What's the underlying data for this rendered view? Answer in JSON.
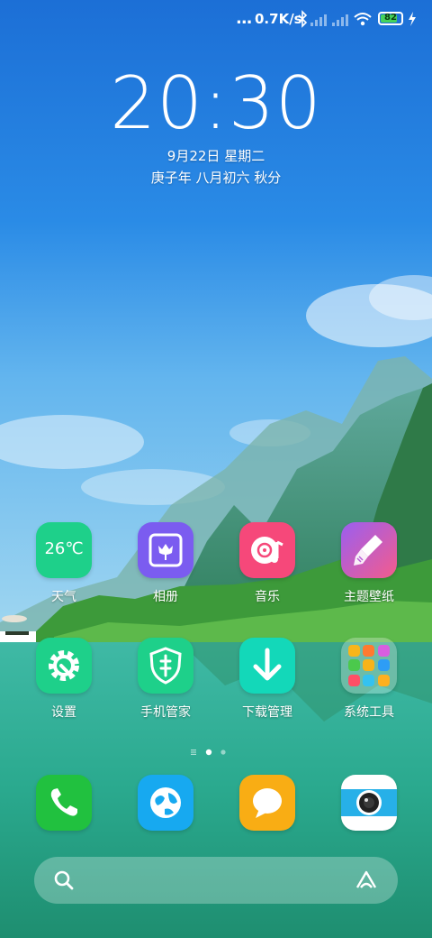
{
  "status_bar": {
    "dots": "...",
    "network_speed": "0.7K/s",
    "icons": [
      "bluetooth-icon",
      "signal-1-icon",
      "signal-2-icon",
      "wifi-icon",
      "battery-icon",
      "charging-icon"
    ],
    "battery_level": "82",
    "battery_fraction": 0.82
  },
  "clock": {
    "time": "20:30",
    "date": "9月22日 星期二",
    "lunar": "庚子年 八月初六 秋分"
  },
  "apps": [
    {
      "label": "天气",
      "icon": "weather-icon",
      "icon_text": "26℃",
      "color": "#1ed08a"
    },
    {
      "label": "相册",
      "icon": "gallery-icon",
      "color": "#7b5cf0"
    },
    {
      "label": "音乐",
      "icon": "music-icon",
      "color": "#f6487a"
    },
    {
      "label": "主题壁纸",
      "icon": "theme-brush-icon",
      "color": "#b85ed8"
    },
    {
      "label": "设置",
      "icon": "settings-gear-icon",
      "color": "#1ed08a"
    },
    {
      "label": "手机管家",
      "icon": "security-shield-icon",
      "color": "#1ed08a"
    },
    {
      "label": "下载管理",
      "icon": "download-arrow-icon",
      "color": "#13d8b9"
    },
    {
      "label": "系统工具",
      "icon": "folder-icon",
      "color": "transparent"
    }
  ],
  "dock": [
    {
      "icon": "phone-icon",
      "color": "#21c13f"
    },
    {
      "icon": "browser-globe-icon",
      "color": "#17a9f0"
    },
    {
      "icon": "messages-icon",
      "color": "#f9ad14"
    },
    {
      "icon": "camera-icon",
      "color": "#ffffff"
    }
  ],
  "page_indicator": {
    "pages": 3,
    "current": 2
  },
  "search": {
    "left_icon": "search-icon",
    "right_icon": "assistant-icon"
  }
}
